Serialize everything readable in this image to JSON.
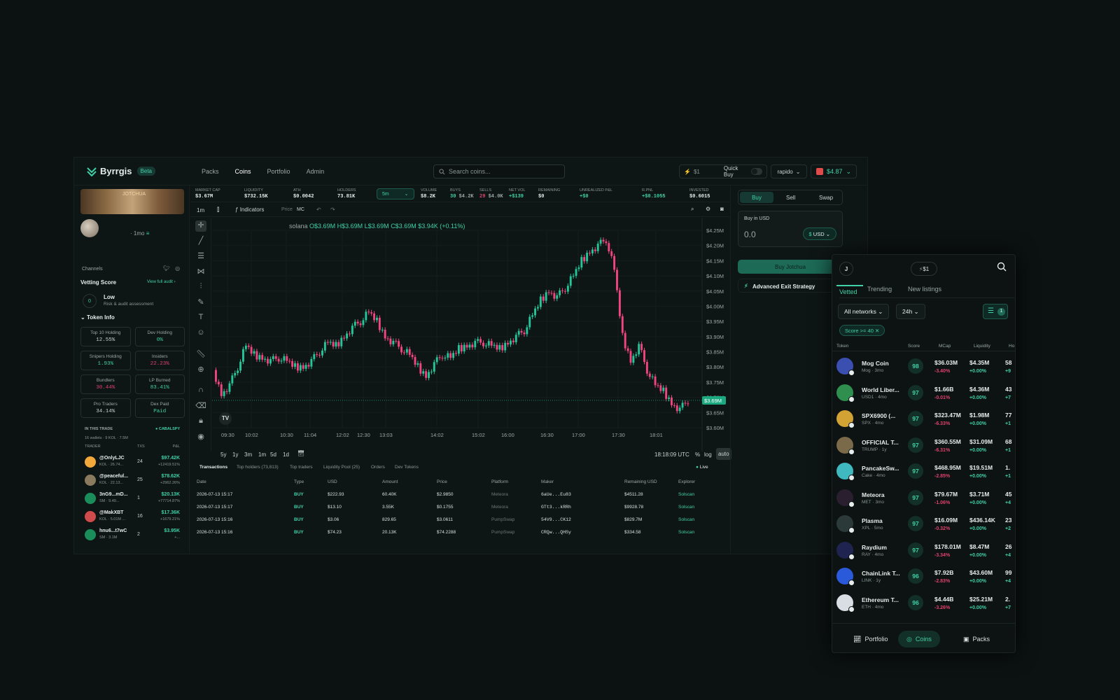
{
  "brand": {
    "name": "Byrrgis",
    "badge": "Beta"
  },
  "nav": [
    {
      "label": "Packs"
    },
    {
      "label": "Coins"
    },
    {
      "label": "Portfolio"
    },
    {
      "label": "Admin"
    }
  ],
  "search": {
    "placeholder": "Search coins..."
  },
  "quickbuy": {
    "amount": "$1",
    "label": "Quick Buy"
  },
  "preset": "rapido",
  "wallet": "$4.87",
  "token": {
    "banner_text": "JOTCHUA",
    "age": "1mo"
  },
  "left": {
    "channels": "Channels",
    "vetting_title": "Vetting Score",
    "view_audit": "View full audit",
    "score": "0",
    "risk": "Low",
    "risk_sub": "Risk & audit assessment",
    "token_info": "Token Info",
    "info": [
      {
        "k": "Top 10 Holding",
        "v": "12.55%",
        "color": "#c8d2d0"
      },
      {
        "k": "Dev Holding",
        "v": "0%",
        "color": "#3fd1a8"
      },
      {
        "k": "Snipers Holding",
        "v": "1.93%",
        "color": "#3fd1a8"
      },
      {
        "k": "Insiders",
        "v": "22.23%",
        "color": "#e0416e"
      },
      {
        "k": "Bundlers",
        "v": "30.44%",
        "color": "#e0416e"
      },
      {
        "k": "LP Burned",
        "v": "83.41%",
        "color": "#3fd1a8"
      },
      {
        "k": "Pro Traders",
        "v": "34.14%",
        "color": "#c8d2d0"
      },
      {
        "k": "Dex Paid",
        "v": "Paid",
        "color": "#3fd1a8"
      }
    ],
    "in_this_trade": "IN THIS TRADE",
    "cabalspy": "CABALSPY",
    "wallets_sub": "16 wallets · 9 KOL · 7.5M",
    "trader_hdr": {
      "trader": "TRADER",
      "txs": "TXS",
      "pnl": "P&L"
    },
    "traders": [
      {
        "name": "@OnlyLJC",
        "sub": "KOL · 26.74...",
        "txs": "24",
        "pnl": "$97.42K",
        "pct": "+12419.51%",
        "color": "#f2a83a"
      },
      {
        "name": "@peaceful...",
        "sub": "KOL · 22.13...",
        "txs": "25",
        "pnl": "$78.62K",
        "pct": "+2962.26%",
        "color": "#8a7a5e"
      },
      {
        "name": "3nG9...mD...",
        "sub": "SM · 9.49...",
        "txs": "1",
        "pnl": "$20.13K",
        "pct": "+77714.87%",
        "color": "#1b8d5a"
      },
      {
        "name": "@MakXBT",
        "sub": "KOL · 5.01M ...",
        "txs": "16",
        "pnl": "$17.36K",
        "pct": "+1679.21%",
        "color": "#d04c4c"
      },
      {
        "name": "hnu6...t7wC",
        "sub": "SM · 3.1M",
        "txs": "2",
        "pnl": "$3.95K",
        "pct": "+...",
        "color": "#1b8d5a"
      }
    ]
  },
  "stats": [
    {
      "k": "MARKET CAP",
      "v": "$3.67M",
      "c": "#e6eceb"
    },
    {
      "k": "LIQUIDITY",
      "v": "$732.15K",
      "c": "#e6eceb"
    },
    {
      "k": "ATH",
      "v": "$0.0042",
      "c": "#e6eceb"
    },
    {
      "k": "HOLDERS",
      "v": "73.81K",
      "c": "#e6eceb"
    }
  ],
  "timeframe": "5m",
  "stats2": [
    {
      "k": "VOLUME",
      "v": "$8.2K",
      "c": "#e6eceb"
    },
    {
      "k": "BUYS",
      "v": "30",
      "v2": "$4.2K",
      "c": "#3fd1a8"
    },
    {
      "k": "SELLS",
      "v": "29",
      "v2": "$4.0K",
      "c": "#e0416e"
    },
    {
      "k": "NET VOL",
      "v": "+$139",
      "c": "#3fd1a8"
    },
    {
      "k": "REMAINING",
      "v": "$0",
      "c": "#e6eceb"
    },
    {
      "k": "UNREALIZED P&L",
      "v": "+$0",
      "c": "#3fd1a8"
    },
    {
      "k": "R.PNL",
      "v": "+$0.1055",
      "c": "#3fd1a8"
    },
    {
      "k": "INVESTED",
      "v": "$0.6015",
      "c": "#e6eceb"
    }
  ],
  "toolbar": {
    "interval": "1m",
    "indicators": "Indicators",
    "price": "Price",
    "mc": "MC"
  },
  "ohlc": {
    "symbol": "solana",
    "o": "O$3.69M",
    "h": "H$3.69M",
    "l": "L$3.69M",
    "c": "C$3.69M",
    "chg": "$3.94K (+0.11%)"
  },
  "chart_data": {
    "type": "candlestick",
    "y_ticks": [
      "$4.25M",
      "$4.20M",
      "$4.15M",
      "$4.10M",
      "$4.05M",
      "$4.00M",
      "$3.95M",
      "$3.90M",
      "$3.85M",
      "$3.80M",
      "$3.75M",
      "$3.70M",
      "$3.65M",
      "$3.60M"
    ],
    "ylim": [
      3.6,
      4.25
    ],
    "x_ticks": [
      "09:30",
      "10:02",
      "10:30",
      "11:04",
      "12:02",
      "12:30",
      "13:03",
      "14:02",
      "15:02",
      "16:00",
      "16:30",
      "17:00",
      "17:30",
      "18:01"
    ],
    "last_price": "$3.69M",
    "closes": [
      3.79,
      3.71,
      3.74,
      3.8,
      3.87,
      3.84,
      3.83,
      3.82,
      3.83,
      3.82,
      3.8,
      3.8,
      3.82,
      3.85,
      3.88,
      3.87,
      3.9,
      3.93,
      3.95,
      3.98,
      3.95,
      3.9,
      3.88,
      3.86,
      3.84,
      3.8,
      3.77,
      3.81,
      3.84,
      3.83,
      3.86,
      3.87,
      3.88,
      3.88,
      3.87,
      3.86,
      3.88,
      3.9,
      3.92,
      3.97,
      4.02,
      4.05,
      4.03,
      4.06,
      4.1,
      4.15,
      4.18,
      4.2,
      4.22,
      4.12,
      3.9,
      3.82,
      3.87,
      3.79,
      3.74,
      3.72,
      3.68,
      3.66,
      3.69
    ]
  },
  "ranges": [
    "5y",
    "1y",
    "3m",
    "1m",
    "5d",
    "1d"
  ],
  "clock": "18:18:09 UTC",
  "axis_opts": [
    "%",
    "log",
    "auto"
  ],
  "tabs": [
    "Transactions",
    "Top holders (73,813)",
    "Top traders",
    "Liquidity Pool (25)",
    "Orders",
    "Dev Tokens"
  ],
  "live": "Live",
  "tx_hdr": [
    "Date",
    "Type",
    "USD",
    "Amount",
    "Price",
    "Platform",
    "Maker",
    "Remaining USD",
    "Explorer"
  ],
  "txs": [
    [
      "2026-07-13 15:17",
      "BUY",
      "$222.93",
      "60.40K",
      "$2.9850",
      "Meteora",
      "6aUe...Eu83",
      "$4511.28",
      "Solscan"
    ],
    [
      "2026-07-13 15:17",
      "BUY",
      "$13.10",
      "3.55K",
      "$0.1755",
      "Meteora",
      "GTt3...kRRh",
      "$9928.78",
      "Solscan"
    ],
    [
      "2026-07-13 15:16",
      "BUY",
      "$3.06",
      "829.65",
      "$3.0611",
      "PumpSwap",
      "54V9...CK12",
      "$829.7M",
      "Solscan"
    ],
    [
      "2026-07-13 15:16",
      "BUY",
      "$74.23",
      "20.13K",
      "$74.2288",
      "PumpSwap",
      "CRQw...QHSy",
      "$334.58",
      "Solscan"
    ]
  ],
  "trade": {
    "buy": "Buy",
    "sell": "Sell",
    "swap": "Swap",
    "label": "Buy in USD",
    "amount": "0.0",
    "currency": "USD",
    "cta": "Buy Jotchua",
    "exit": "Advanced Exit Strategy"
  },
  "mobile": {
    "avatar": "J",
    "amount": "$1",
    "tabs": [
      "Vetted",
      "Trending",
      "New listings"
    ],
    "network": "All networks",
    "period": "24h",
    "filter_count": "1",
    "chip": "Score >= 40",
    "hdr": [
      "Token",
      "Score",
      "MCap",
      "Liquidity",
      "Ho"
    ],
    "rows": [
      {
        "name": "Mog Coin",
        "sub": "Mog · 3mo",
        "score": "98",
        "mcap": "$36.03M",
        "chg": "-3.40%",
        "liq": "$4.35M",
        "lchg": "+0.00%",
        "hold": "58",
        "hchg": "+9",
        "color": "#3a4fb0"
      },
      {
        "name": "World Liber...",
        "sub": "USD1 · 4mo",
        "score": "97",
        "mcap": "$1.66B",
        "chg": "-0.01%",
        "liq": "$4.36M",
        "lchg": "+0.00%",
        "hold": "43",
        "hchg": "+7",
        "color": "#2f8f4e"
      },
      {
        "name": "SPX6900 (...",
        "sub": "SPX · 4mo",
        "score": "97",
        "mcap": "$323.47M",
        "chg": "-6.33%",
        "liq": "$1.98M",
        "lchg": "+0.00%",
        "hold": "77",
        "hchg": "+1",
        "color": "#d2a235"
      },
      {
        "name": "OFFICIAL T...",
        "sub": "TRUMP · 1y",
        "score": "97",
        "mcap": "$360.55M",
        "chg": "-6.31%",
        "liq": "$31.09M",
        "lchg": "+0.00%",
        "hold": "68",
        "hchg": "+1",
        "color": "#7a6a4a"
      },
      {
        "name": "PancakeSw...",
        "sub": "Cake · 4mo",
        "score": "97",
        "mcap": "$468.95M",
        "chg": "-2.85%",
        "liq": "$19.51M",
        "lchg": "+0.00%",
        "hold": "1.",
        "hchg": "+1",
        "color": "#3fb8c0"
      },
      {
        "name": "Meteora",
        "sub": "MET · 3mo",
        "score": "97",
        "mcap": "$79.67M",
        "chg": "-1.06%",
        "liq": "$3.71M",
        "lchg": "+0.00%",
        "hold": "45",
        "hchg": "+4",
        "color": "#2a1f2e"
      },
      {
        "name": "Plasma",
        "sub": "XPL · 5mo",
        "score": "97",
        "mcap": "$16.09M",
        "chg": "-0.32%",
        "liq": "$436.14K",
        "lchg": "+0.00%",
        "hold": "23",
        "hchg": "+2",
        "color": "#2b3a38"
      },
      {
        "name": "Raydium",
        "sub": "RAY · 4mo",
        "score": "97",
        "mcap": "$178.01M",
        "chg": "-3.34%",
        "liq": "$8.47M",
        "lchg": "+0.00%",
        "hold": "26",
        "hchg": "+4",
        "color": "#1f2350"
      },
      {
        "name": "ChainLink T...",
        "sub": "LINK · 1y",
        "score": "96",
        "mcap": "$7.92B",
        "chg": "-2.83%",
        "liq": "$43.60M",
        "lchg": "+0.00%",
        "hold": "99",
        "hchg": "+4",
        "color": "#2a5ada"
      },
      {
        "name": "Ethereum T...",
        "sub": "ETH · 4mo",
        "score": "96",
        "mcap": "$4.44B",
        "chg": "-3.26%",
        "liq": "$25.21M",
        "lchg": "+0.00%",
        "hold": "2.",
        "hchg": "+7",
        "color": "#d9dde4"
      }
    ],
    "nav": [
      "Portfolio",
      "Coins",
      "Packs"
    ]
  },
  "colors": {
    "accent": "#3fd1a8",
    "down": "#e0416e",
    "bg": "#0b1211"
  }
}
